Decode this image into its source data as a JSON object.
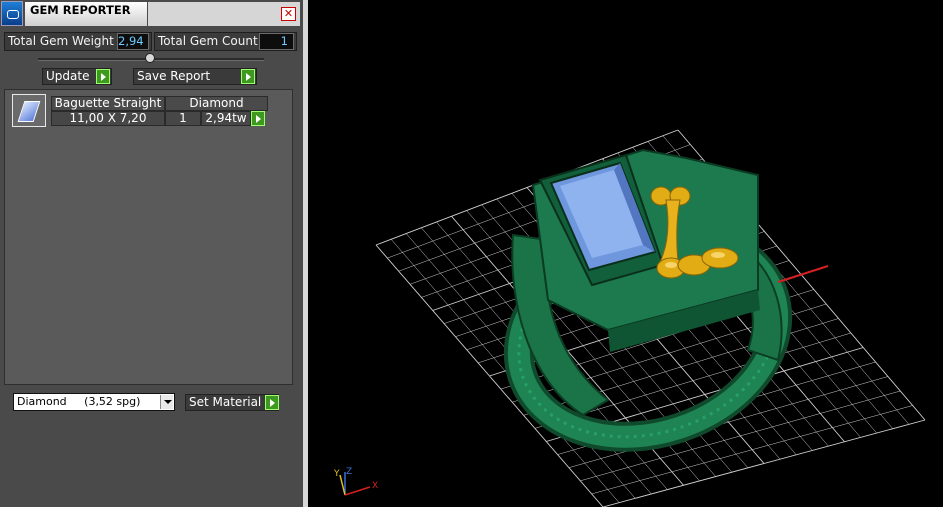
{
  "panel": {
    "title": "GEM REPORTER",
    "close_glyph": "✕",
    "total_weight_label": "Total Gem Weight",
    "total_weight_value": "2,94",
    "total_count_label": "Total Gem Count",
    "total_count_value": "1",
    "update_label": "Update",
    "save_report_label": "Save Report",
    "gems": [
      {
        "shape": "Baguette Straight",
        "material": "Diamond",
        "size": "11,00 X 7,20",
        "count": "1",
        "weight": "2,94tw"
      }
    ],
    "material_select_value": "Diamond     (3,52 spg)",
    "set_material_label": "Set Material"
  },
  "viewport": {
    "axis_x": "X",
    "axis_y": "Y",
    "axis_z": "Z",
    "colors": {
      "background": "#000000",
      "grid": "#d0d0d0",
      "ring": "#1c7a4e",
      "gem": "#7aa3e6",
      "ornament": "#d9a514",
      "axis_x": "#d42020",
      "axis_y": "#e0c21a",
      "axis_z": "#3a6fd8"
    }
  }
}
